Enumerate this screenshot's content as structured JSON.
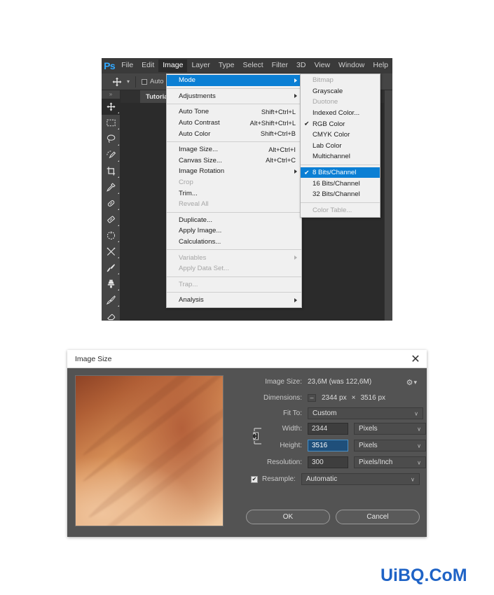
{
  "app": {
    "logo": "Ps",
    "menubar": [
      "File",
      "Edit",
      "Image",
      "Layer",
      "Type",
      "Select",
      "Filter",
      "3D",
      "View",
      "Window",
      "Help"
    ],
    "active_menu": "Image",
    "options_bar": {
      "auto_select_label": "Auto"
    },
    "document_tab": "Tutorial.psd",
    "tools": [
      "move-tool",
      "rectangular-marquee-tool",
      "lasso-tool",
      "quick-selection-tool",
      "crop-tool",
      "eyedropper-tool",
      "spot-healing-brush-tool",
      "healing-brush-tool",
      "patch-tool",
      "shuffle-tool",
      "brush-tool",
      "clone-stamp-tool",
      "history-brush-tool",
      "eraser-tool"
    ]
  },
  "image_menu": {
    "groups": [
      [
        {
          "label": "Mode",
          "shortcut": "",
          "submenu": true,
          "highlighted": true,
          "disabled": false,
          "checked": false
        }
      ],
      [
        {
          "label": "Adjustments",
          "shortcut": "",
          "submenu": true,
          "highlighted": false,
          "disabled": false,
          "checked": false
        }
      ],
      [
        {
          "label": "Auto Tone",
          "shortcut": "Shift+Ctrl+L",
          "submenu": false,
          "highlighted": false,
          "disabled": false,
          "checked": false
        },
        {
          "label": "Auto Contrast",
          "shortcut": "Alt+Shift+Ctrl+L",
          "submenu": false,
          "highlighted": false,
          "disabled": false,
          "checked": false
        },
        {
          "label": "Auto Color",
          "shortcut": "Shift+Ctrl+B",
          "submenu": false,
          "highlighted": false,
          "disabled": false,
          "checked": false
        }
      ],
      [
        {
          "label": "Image Size...",
          "shortcut": "Alt+Ctrl+I",
          "submenu": false,
          "highlighted": false,
          "disabled": false,
          "checked": false
        },
        {
          "label": "Canvas Size...",
          "shortcut": "Alt+Ctrl+C",
          "submenu": false,
          "highlighted": false,
          "disabled": false,
          "checked": false
        },
        {
          "label": "Image Rotation",
          "shortcut": "",
          "submenu": true,
          "highlighted": false,
          "disabled": false,
          "checked": false
        },
        {
          "label": "Crop",
          "shortcut": "",
          "submenu": false,
          "highlighted": false,
          "disabled": true,
          "checked": false
        },
        {
          "label": "Trim...",
          "shortcut": "",
          "submenu": false,
          "highlighted": false,
          "disabled": false,
          "checked": false
        },
        {
          "label": "Reveal All",
          "shortcut": "",
          "submenu": false,
          "highlighted": false,
          "disabled": true,
          "checked": false
        }
      ],
      [
        {
          "label": "Duplicate...",
          "shortcut": "",
          "submenu": false,
          "highlighted": false,
          "disabled": false,
          "checked": false
        },
        {
          "label": "Apply Image...",
          "shortcut": "",
          "submenu": false,
          "highlighted": false,
          "disabled": false,
          "checked": false
        },
        {
          "label": "Calculations...",
          "shortcut": "",
          "submenu": false,
          "highlighted": false,
          "disabled": false,
          "checked": false
        }
      ],
      [
        {
          "label": "Variables",
          "shortcut": "",
          "submenu": true,
          "highlighted": false,
          "disabled": true,
          "checked": false
        },
        {
          "label": "Apply Data Set...",
          "shortcut": "",
          "submenu": false,
          "highlighted": false,
          "disabled": true,
          "checked": false
        }
      ],
      [
        {
          "label": "Trap...",
          "shortcut": "",
          "submenu": false,
          "highlighted": false,
          "disabled": true,
          "checked": false
        }
      ],
      [
        {
          "label": "Analysis",
          "shortcut": "",
          "submenu": true,
          "highlighted": false,
          "disabled": false,
          "checked": false
        }
      ]
    ]
  },
  "mode_submenu": {
    "groups": [
      [
        {
          "label": "Bitmap",
          "disabled": true,
          "checked": false,
          "highlighted": false
        },
        {
          "label": "Grayscale",
          "disabled": false,
          "checked": false,
          "highlighted": false
        },
        {
          "label": "Duotone",
          "disabled": true,
          "checked": false,
          "highlighted": false
        },
        {
          "label": "Indexed Color...",
          "disabled": false,
          "checked": false,
          "highlighted": false
        },
        {
          "label": "RGB Color",
          "disabled": false,
          "checked": true,
          "highlighted": false
        },
        {
          "label": "CMYK Color",
          "disabled": false,
          "checked": false,
          "highlighted": false
        },
        {
          "label": "Lab Color",
          "disabled": false,
          "checked": false,
          "highlighted": false
        },
        {
          "label": "Multichannel",
          "disabled": false,
          "checked": false,
          "highlighted": false
        }
      ],
      [
        {
          "label": "8 Bits/Channel",
          "disabled": false,
          "checked": true,
          "highlighted": true
        },
        {
          "label": "16 Bits/Channel",
          "disabled": false,
          "checked": false,
          "highlighted": false
        },
        {
          "label": "32 Bits/Channel",
          "disabled": false,
          "checked": false,
          "highlighted": false
        }
      ],
      [
        {
          "label": "Color Table...",
          "disabled": true,
          "checked": false,
          "highlighted": false
        }
      ]
    ]
  },
  "dialog": {
    "title": "Image Size",
    "close_glyph": "✕",
    "image_size_label": "Image Size:",
    "image_size_value": "23,6M (was 122,6M)",
    "dimensions_label": "Dimensions:",
    "dimensions_minus": "–",
    "dimensions_width": "2344 px",
    "dimensions_x": "×",
    "dimensions_height": "3516 px",
    "fit_to_label": "Fit To:",
    "fit_to_value": "Custom",
    "width_label": "Width:",
    "width_value": "2344",
    "width_unit": "Pixels",
    "height_label": "Height:",
    "height_value": "3516",
    "height_unit": "Pixels",
    "resolution_label": "Resolution:",
    "resolution_value": "300",
    "resolution_unit": "Pixels/Inch",
    "resample_label": "Resample:",
    "resample_value": "Automatic",
    "resample_checked": "✔",
    "ok_label": "OK",
    "cancel_label": "Cancel",
    "gear_glyph": "⚙",
    "gear_dot": "▾",
    "chevron": "∨"
  },
  "watermark": {
    "text": "UiBQ.CoM",
    "color": "#1f63c6"
  },
  "colors": {
    "accent_blue": "#0b7fd4",
    "ps_logo_blue": "#31a8ff",
    "menu_bg": "#f0f0f0",
    "dialog_bg": "#535353",
    "ps_panel": "#454545",
    "ps_canvas": "#2b2b2b",
    "field_selected": "#1f4f7a"
  }
}
